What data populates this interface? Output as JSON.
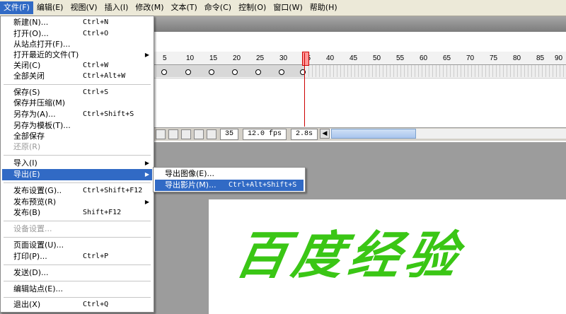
{
  "menubar": [
    {
      "label": "文件(F)"
    },
    {
      "label": "编辑(E)"
    },
    {
      "label": "视图(V)"
    },
    {
      "label": "插入(I)"
    },
    {
      "label": "修改(M)"
    },
    {
      "label": "文本(T)"
    },
    {
      "label": "命令(C)"
    },
    {
      "label": "控制(O)"
    },
    {
      "label": "窗口(W)"
    },
    {
      "label": "帮助(H)"
    }
  ],
  "file_menu": [
    {
      "label": "新建(N)...",
      "shortcut": "Ctrl+N"
    },
    {
      "label": "打开(O)...",
      "shortcut": "Ctrl+O"
    },
    {
      "label": "从站点打开(F)..."
    },
    {
      "label": "打开最近的文件(T)",
      "arrow": "▶"
    },
    {
      "label": "关闭(C)",
      "shortcut": "Ctrl+W"
    },
    {
      "label": "全部关闭",
      "shortcut": "Ctrl+Alt+W"
    },
    {
      "label": "保存(S)",
      "shortcut": "Ctrl+S"
    },
    {
      "label": "保存并压缩(M)"
    },
    {
      "label": "另存为(A)...",
      "shortcut": "Ctrl+Shift+S"
    },
    {
      "label": "另存为模板(T)..."
    },
    {
      "label": "全部保存"
    },
    {
      "label": "还原(R)"
    },
    {
      "label": "导入(I)",
      "arrow": "▶"
    },
    {
      "label": "导出(E)",
      "arrow": "▶"
    },
    {
      "label": "发布设置(G)..",
      "shortcut": "Ctrl+Shift+F12"
    },
    {
      "label": "发布预览(R)",
      "arrow": "▶"
    },
    {
      "label": "发布(B)",
      "shortcut": "Shift+F12"
    },
    {
      "label": "设备设置..."
    },
    {
      "label": "页面设置(U)..."
    },
    {
      "label": "打印(P)...",
      "shortcut": "Ctrl+P"
    },
    {
      "label": "发送(D)..."
    },
    {
      "label": "编辑站点(E)..."
    },
    {
      "label": "退出(X)",
      "shortcut": "Ctrl+Q"
    }
  ],
  "export_menu": [
    {
      "label": "导出图像(E)..."
    },
    {
      "label": "导出影片(M)...",
      "shortcut": "Ctrl+Alt+Shift+S"
    }
  ],
  "timeline": {
    "ruler": [
      "5",
      "10",
      "15",
      "20",
      "25",
      "30",
      "35",
      "40",
      "45",
      "50",
      "55",
      "60",
      "65",
      "70",
      "75",
      "80",
      "85",
      "90"
    ],
    "current_frame": "35",
    "fps": "12.0 fps",
    "elapsed": "2.8s"
  },
  "stage": {
    "text": "百度经验"
  },
  "colors": {
    "menu_highlight": "#316ac5",
    "stage_text": "#3ac615",
    "playhead": "#cc0000"
  }
}
